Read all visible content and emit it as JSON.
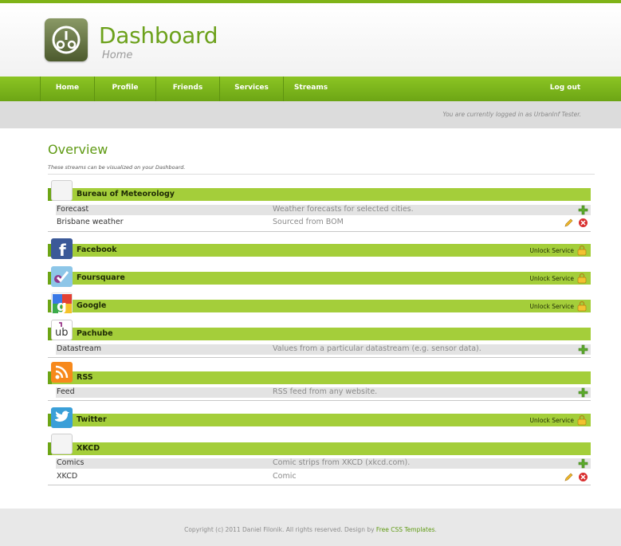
{
  "app": {
    "title": "Dashboard",
    "subtitle": "Home",
    "logo_icon": "gauge-icon",
    "accent": "#7fb317",
    "header_green": "#a4ce3a"
  },
  "nav": {
    "items": [
      {
        "label": "Home"
      },
      {
        "label": "Profile"
      },
      {
        "label": "Friends"
      },
      {
        "label": "Services"
      },
      {
        "label": "Streams"
      }
    ],
    "logout": "Log out"
  },
  "status": {
    "logged_in": "You are currently logged in as UrbanInf Tester."
  },
  "overview": {
    "title": "Overview",
    "subtitle": "These streams can be visualized on your Dashboard."
  },
  "services": [
    {
      "name": "Bureau of Meteorology",
      "icon": "blank-icon",
      "rows": [
        {
          "name": "Forecast",
          "desc": "Weather forecasts for selected cities.",
          "actions": [
            "add"
          ]
        },
        {
          "name": "Brisbane weather",
          "desc": "Sourced from BOM",
          "actions": [
            "edit",
            "delete"
          ]
        }
      ]
    },
    {
      "name": "Facebook",
      "icon": "facebook-icon",
      "unlock": "Unlock Service"
    },
    {
      "name": "Foursquare",
      "icon": "foursquare-icon",
      "unlock": "Unlock Service"
    },
    {
      "name": "Google",
      "icon": "google-icon",
      "unlock": "Unlock Service"
    },
    {
      "name": "Pachube",
      "icon": "pachube-icon",
      "rows": [
        {
          "name": "Datastream",
          "desc": "Values from a particular datastream (e.g. sensor data).",
          "actions": [
            "add"
          ]
        }
      ]
    },
    {
      "name": "RSS",
      "icon": "rss-icon",
      "rows": [
        {
          "name": "Feed",
          "desc": "RSS feed from any website.",
          "actions": [
            "add"
          ]
        }
      ]
    },
    {
      "name": "Twitter",
      "icon": "twitter-icon",
      "unlock": "Unlock Service"
    },
    {
      "name": "XKCD",
      "icon": "blank-icon",
      "rows": [
        {
          "name": "Comics",
          "desc": "Comic strips from XKCD (xkcd.com).",
          "actions": [
            "add"
          ]
        },
        {
          "name": "XKCD",
          "desc": "Comic",
          "actions": [
            "edit",
            "delete"
          ]
        }
      ]
    }
  ],
  "footer": {
    "text": "Copyright (c) 2011 Daniel Filonik. All rights reserved. Design by",
    "link": "Free CSS Templates",
    "end": "."
  }
}
